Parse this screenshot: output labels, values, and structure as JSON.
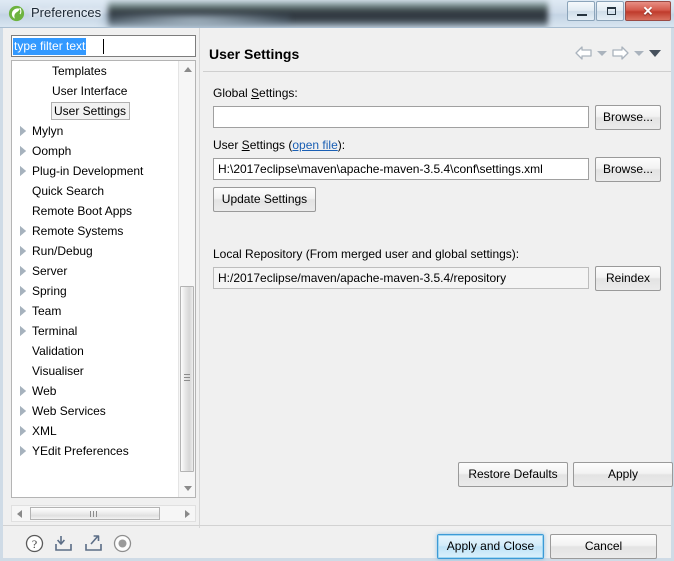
{
  "window": {
    "title": "Preferences",
    "icon": "eclipse-spring-icon",
    "controls": {
      "minimize": "Minimize",
      "maximize": "Maximize",
      "close": "Close"
    }
  },
  "sidebar": {
    "filter": {
      "value": "type filter text",
      "placeholder": "type filter text",
      "selected": true
    },
    "tree_items": [
      {
        "label": "Templates",
        "indent": 1,
        "arrow": false,
        "selected": false
      },
      {
        "label": "User Interface",
        "indent": 1,
        "arrow": false,
        "selected": false
      },
      {
        "label": "User Settings",
        "indent": 1,
        "arrow": false,
        "selected": true
      },
      {
        "label": "Mylyn",
        "indent": 0,
        "arrow": true,
        "selected": false
      },
      {
        "label": "Oomph",
        "indent": 0,
        "arrow": true,
        "selected": false
      },
      {
        "label": "Plug-in Development",
        "indent": 0,
        "arrow": true,
        "selected": false
      },
      {
        "label": "Quick Search",
        "indent": 0,
        "arrow": false,
        "selected": false
      },
      {
        "label": "Remote Boot Apps",
        "indent": 0,
        "arrow": false,
        "selected": false
      },
      {
        "label": "Remote Systems",
        "indent": 0,
        "arrow": true,
        "selected": false
      },
      {
        "label": "Run/Debug",
        "indent": 0,
        "arrow": true,
        "selected": false
      },
      {
        "label": "Server",
        "indent": 0,
        "arrow": true,
        "selected": false
      },
      {
        "label": "Spring",
        "indent": 0,
        "arrow": true,
        "selected": false
      },
      {
        "label": "Team",
        "indent": 0,
        "arrow": true,
        "selected": false
      },
      {
        "label": "Terminal",
        "indent": 0,
        "arrow": true,
        "selected": false
      },
      {
        "label": "Validation",
        "indent": 0,
        "arrow": false,
        "selected": false
      },
      {
        "label": "Visualiser",
        "indent": 0,
        "arrow": false,
        "selected": false
      },
      {
        "label": "Web",
        "indent": 0,
        "arrow": true,
        "selected": false
      },
      {
        "label": "Web Services",
        "indent": 0,
        "arrow": true,
        "selected": false
      },
      {
        "label": "XML",
        "indent": 0,
        "arrow": true,
        "selected": false
      },
      {
        "label": "YEdit Preferences",
        "indent": 0,
        "arrow": true,
        "selected": false
      }
    ]
  },
  "page": {
    "title": "User Settings",
    "nav": {
      "back_icon": "back-arrow-icon",
      "back_menu_icon": "chevron-down-icon",
      "forward_icon": "forward-arrow-icon",
      "forward_menu_icon": "chevron-down-icon",
      "view_menu_icon": "chevron-down-icon"
    },
    "global_settings": {
      "label_before": "Global ",
      "label_mnemonic": "S",
      "label_after": "ettings:",
      "value": "",
      "browse_label": "Browse..."
    },
    "user_settings": {
      "label_before": "User ",
      "label_mnemonic": "S",
      "label_mid": "ettings (",
      "link": "open file",
      "label_after": "):",
      "value": "H:\\2017eclipse\\maven\\apache-maven-3.5.4\\conf\\settings.xml",
      "browse_label": "Browse...",
      "update_label": "Update Settings"
    },
    "local_repository": {
      "label": "Local Repository (From merged user and global settings):",
      "value": "H:/2017eclipse/maven/apache-maven-3.5.4/repository",
      "reindex_label": "Reindex"
    },
    "restore_defaults_label": "Restore Defaults",
    "apply_label": "Apply"
  },
  "footer": {
    "icons": [
      {
        "name": "help-icon",
        "title": "Help"
      },
      {
        "name": "import-icon",
        "title": "Import"
      },
      {
        "name": "export-icon",
        "title": "Export"
      },
      {
        "name": "record-icon",
        "title": "Record"
      }
    ],
    "apply_and_close_label": "Apply and Close",
    "cancel_label": "Cancel"
  },
  "colors": {
    "accent": "#3399ff",
    "link": "#1a5fb4",
    "default_button_border": "#3c9ad6",
    "close_button": "#bf3b2c",
    "dialog_bg": "#f0f0f0"
  }
}
